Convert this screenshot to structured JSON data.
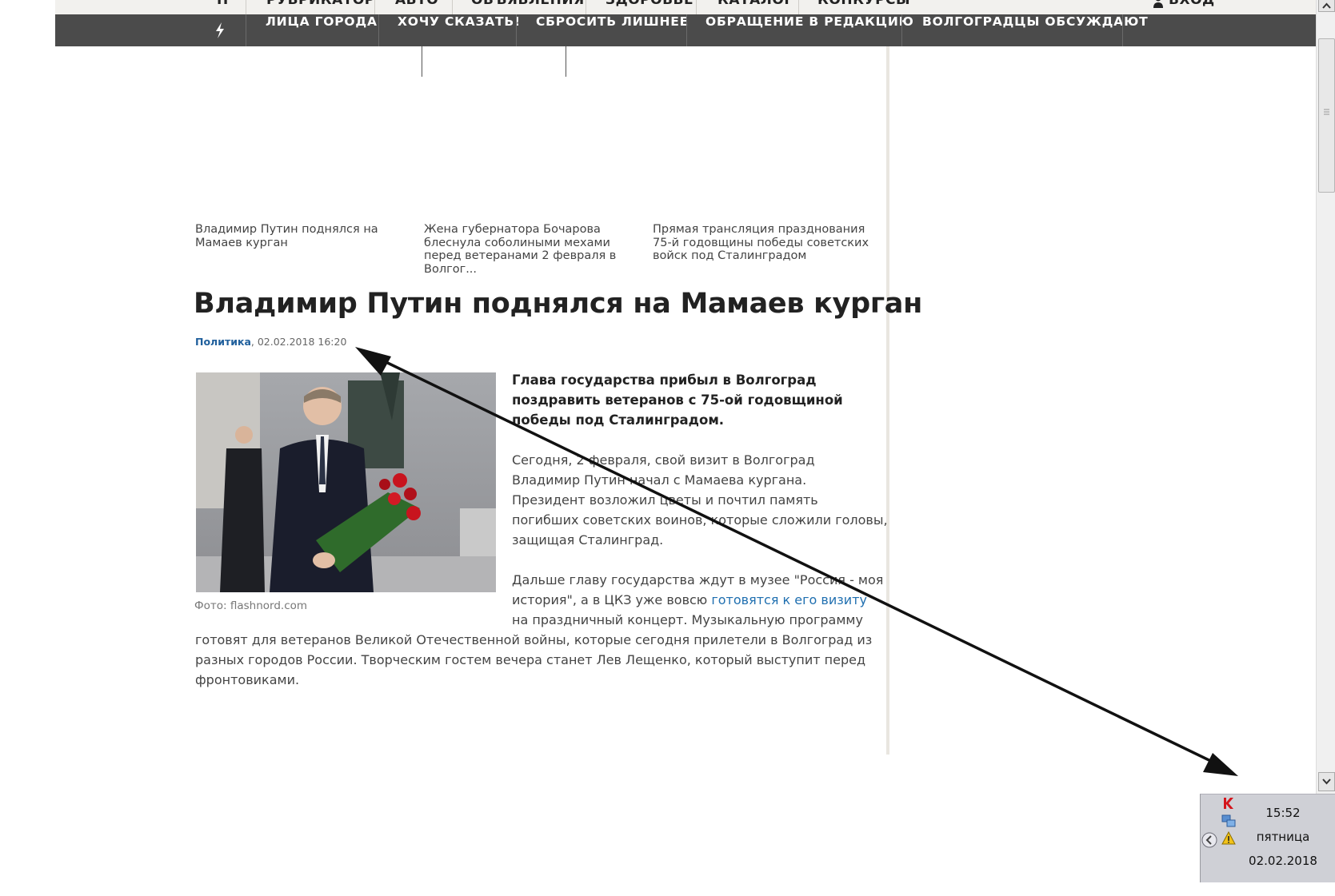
{
  "top_nav": {
    "items": [
      "Н",
      "РУБРИКАТОР",
      "АВТО",
      "ОБЪЯВЛЕНИЯ",
      "ЗДОРОВЬЕ",
      "КАТАЛОГ",
      "КОНКУРСЫ"
    ],
    "login_label": "ВХОД"
  },
  "main_nav": {
    "items": [
      "ЛИЦА ГОРОДА",
      "ХОЧУ СКАЗАТЬ!",
      "СБРОСИТЬ ЛИШНЕЕ",
      "ОБРАЩЕНИЕ В РЕДАКЦИЮ",
      "ВОЛГОГРАДЦЫ ОБСУЖДАЮТ"
    ],
    "icon": "lightning-icon"
  },
  "related": [
    "Владимир Путин поднялся на Мамаев курган",
    "Жена губернатора Бочарова блеснула соболиными мехами перед ветеранами 2 февраля в Волгог...",
    "Прямая трансляция празднования 75-й годовщины победы советских войск под Сталинградом"
  ],
  "article": {
    "title": "Владимир Путин поднялся на Мамаев курган",
    "category": "Политика",
    "datetime": ", 02.02.2018 16:20",
    "photo_caption": "Фото: flashnord.com",
    "lead": "Глава государства прибыл в Волгоград поздравить ветеранов с 75-ой годовщиной победы под Сталинградом.",
    "p1": [
      "Сегодня, 2 февраля, свой визит в Волгоград",
      "Владимир Путин начал с Мамаева кургана.",
      "Президент возложил цветы и почтил память",
      "погибших советских воинов, которые сложили головы,",
      "защищая Сталинград."
    ],
    "p2_lines": [
      "Дальше главу государства ждут в музее \"Россия - моя",
      "на праздничный концерт. Музыкальную программу",
      "готовят для ветеранов Великой Отечественной войны, которые сегодня прилетели в Волгоград из",
      "разных городов России. Творческим гостем вечера станет Лев Лещенко, который выступит перед",
      "фронтовиками."
    ],
    "p2_line2_before": "история\", а в ЦКЗ уже вовсю ",
    "p2_link": "готовятся к его визиту"
  },
  "tray": {
    "time": "15:52",
    "weekday": "пятница",
    "date": "02.02.2018",
    "icons": [
      "kaspersky-icon",
      "network-icon",
      "warning-icon"
    ]
  }
}
